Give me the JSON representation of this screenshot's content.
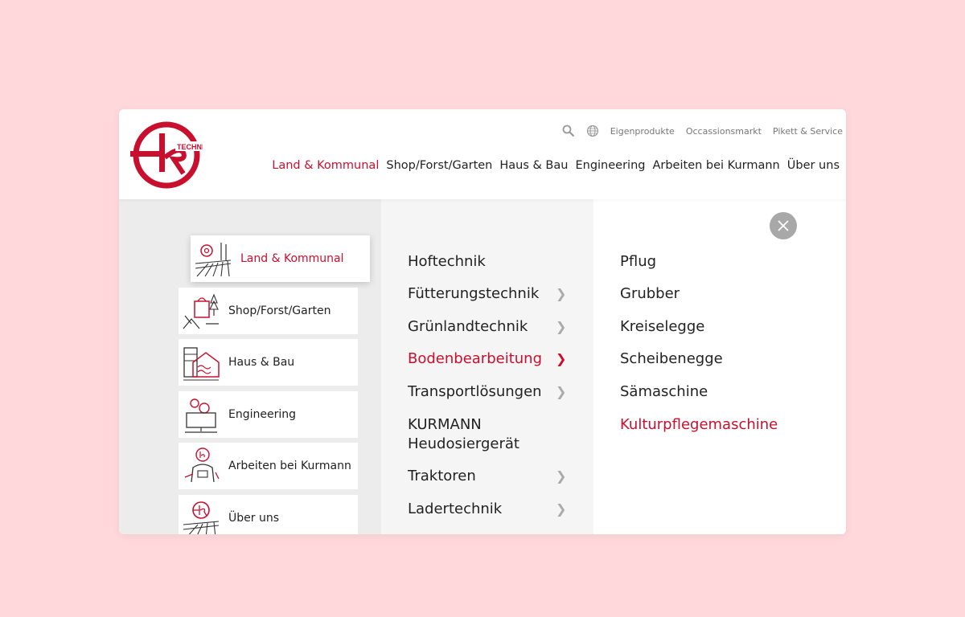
{
  "brand": {
    "logo_text": "TECHNIK",
    "accent": "#c8102e"
  },
  "topbar": {
    "search_icon": "search-icon",
    "globe_icon": "globe-icon",
    "links": [
      "Eigenprodukte",
      "Occassionsmarkt",
      "Pikett & Service"
    ]
  },
  "mainnav": [
    "Land & Kommunal",
    "Shop/Forst/Garten",
    "Haus & Bau",
    "Engineering",
    "Arbeiten bei Kurmann",
    "Über uns"
  ],
  "categories": [
    "Land & Kommunal",
    "Shop/Forst/Garten",
    "Haus & Bau",
    "Engineering",
    "Arbeiten bei Kurmann",
    "Über uns"
  ],
  "submenu": [
    {
      "label": "Hoftechnik"
    },
    {
      "label": "Fütterungstechnik"
    },
    {
      "label": "Grünlandtechnik"
    },
    {
      "label": "Bodenbearbeitung"
    },
    {
      "label": "Transportlösungen"
    },
    {
      "label_line1": "KURMANN",
      "label_line2": "Heudosiergerät"
    },
    {
      "label": "Traktoren"
    },
    {
      "label": "Ladertechnik"
    }
  ],
  "chevron": "❯",
  "products": [
    "Pflug",
    "Grubber",
    "Kreiselegge",
    "Scheibenegge",
    "Sämaschine",
    "Kulturpflegemaschine"
  ]
}
